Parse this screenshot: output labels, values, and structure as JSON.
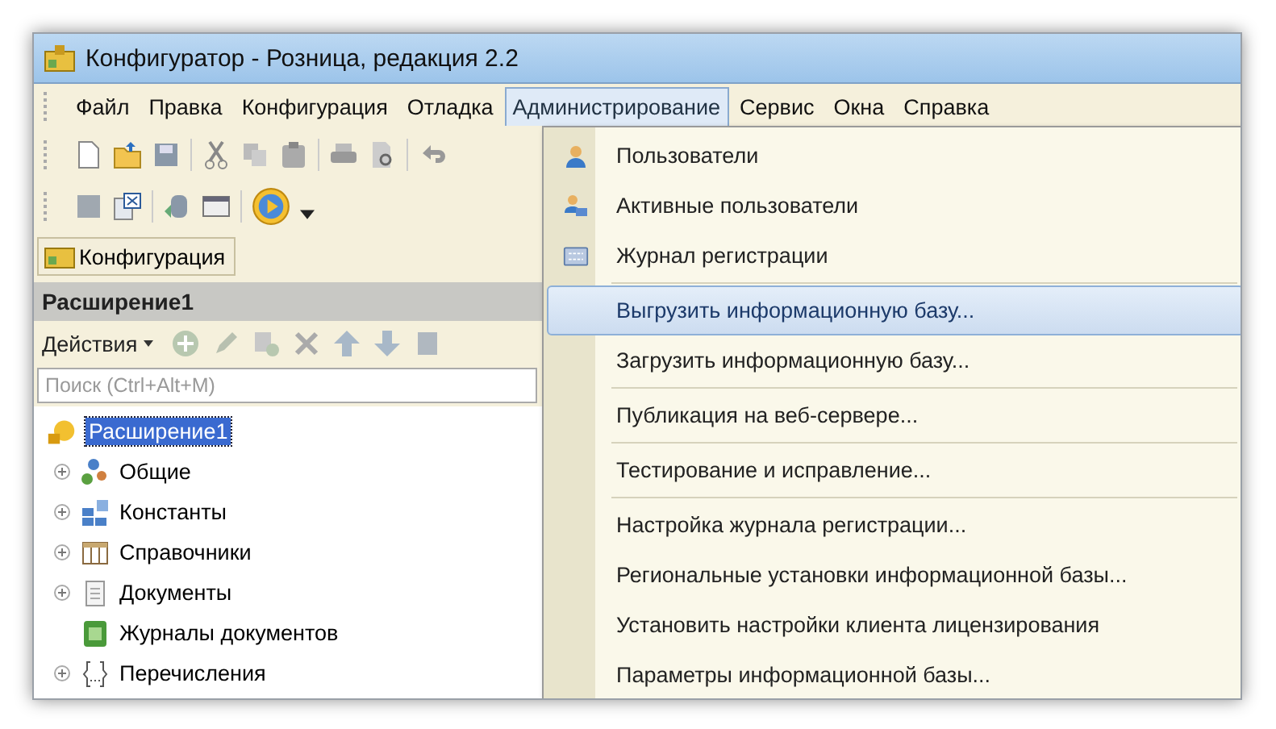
{
  "window": {
    "title": "Конфигуратор - Розница, редакция 2.2"
  },
  "menu_bar": [
    {
      "label": "Файл",
      "selected": false
    },
    {
      "label": "Правка",
      "selected": false
    },
    {
      "label": "Конфигурация",
      "selected": false
    },
    {
      "label": "Отладка",
      "selected": false
    },
    {
      "label": "Администрирование",
      "selected": true
    },
    {
      "label": "Сервис",
      "selected": false
    },
    {
      "label": "Окна",
      "selected": false
    },
    {
      "label": "Справка",
      "selected": false
    }
  ],
  "config_tab": {
    "label": "Конфигурация"
  },
  "panel": {
    "title": "Расширение1",
    "actions_label": "Действия",
    "search": {
      "placeholder": "Поиск (Ctrl+Alt+M)"
    }
  },
  "tree": {
    "root": {
      "label": "Расширение1",
      "selected": true
    },
    "children": [
      {
        "label": "Общие",
        "kind": "common",
        "expandable": true
      },
      {
        "label": "Константы",
        "kind": "constants",
        "expandable": true
      },
      {
        "label": "Справочники",
        "kind": "catalogs",
        "expandable": true
      },
      {
        "label": "Документы",
        "kind": "documents",
        "expandable": true
      },
      {
        "label": "Журналы документов",
        "kind": "journals",
        "expandable": false
      },
      {
        "label": "Перечисления",
        "kind": "enums",
        "expandable": true
      }
    ]
  },
  "dropdown": {
    "groups": [
      [
        {
          "label": "Пользователи",
          "kind": "user",
          "selected": false
        },
        {
          "label": "Активные пользователи",
          "kind": "active-users",
          "selected": false
        },
        {
          "label": "Журнал регистрации",
          "kind": "log",
          "selected": false
        }
      ],
      [
        {
          "label": "Выгрузить информационную базу...",
          "kind": "plain",
          "selected": true
        },
        {
          "label": "Загрузить информационную базу...",
          "kind": "plain",
          "selected": false
        }
      ],
      [
        {
          "label": "Публикация на веб-сервере...",
          "kind": "plain",
          "selected": false
        }
      ],
      [
        {
          "label": "Тестирование и исправление...",
          "kind": "plain",
          "selected": false
        }
      ],
      [
        {
          "label": "Настройка журнала регистрации...",
          "kind": "plain",
          "selected": false
        },
        {
          "label": "Региональные установки информационной базы...",
          "kind": "plain",
          "selected": false
        },
        {
          "label": "Установить настройки клиента лицензирования",
          "kind": "plain",
          "selected": false
        },
        {
          "label": "Параметры информационной базы...",
          "kind": "plain",
          "selected": false
        }
      ]
    ]
  }
}
